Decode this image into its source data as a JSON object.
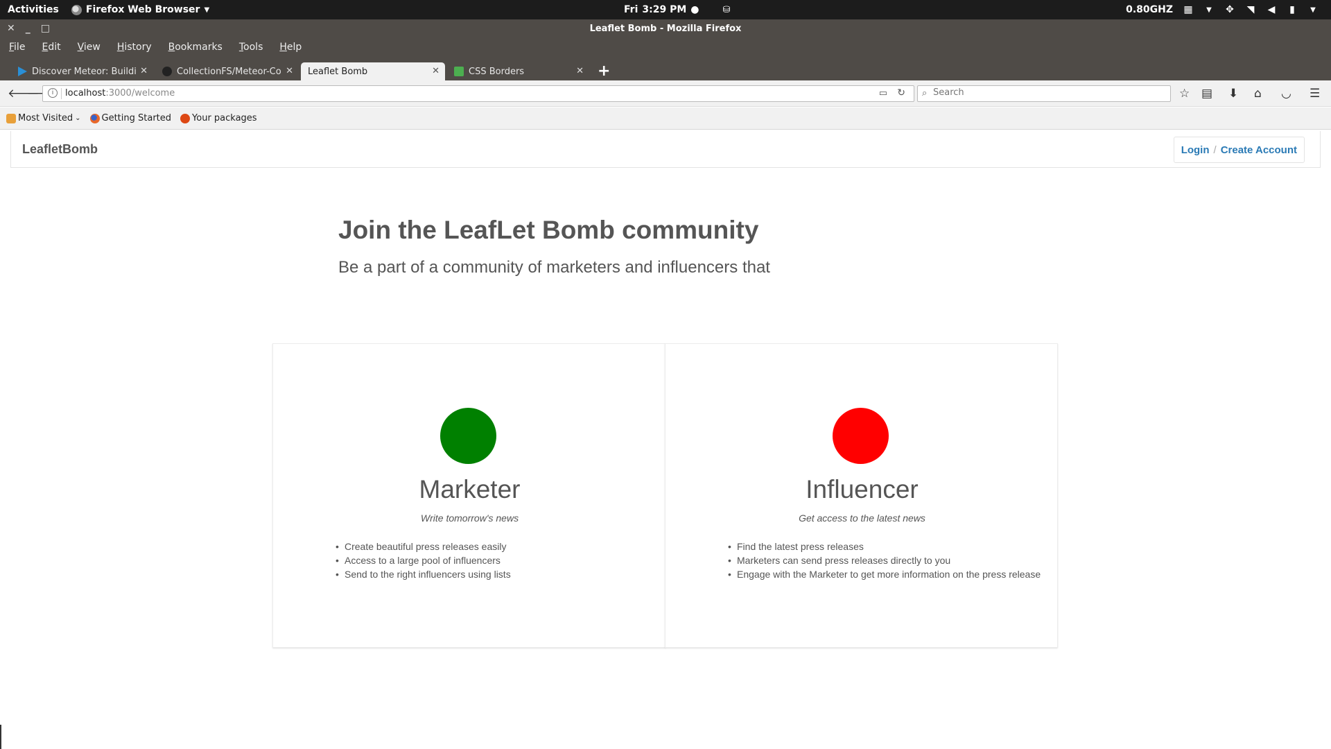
{
  "topbar": {
    "activities": "Activities",
    "app_name": "Firefox Web Browser",
    "clock_day": "Fri",
    "clock_time": "3:29 PM",
    "cpu": "0.80GHZ"
  },
  "window": {
    "title": "Leaflet Bomb - Mozilla Firefox"
  },
  "menu": [
    "File",
    "Edit",
    "View",
    "History",
    "Bookmarks",
    "Tools",
    "Help"
  ],
  "tabs": [
    {
      "label": "Discover Meteor: Building",
      "icon": "play-icon",
      "color": "#2a8fd6"
    },
    {
      "label": "CollectionFS/Meteor-Coll",
      "icon": "github-icon",
      "color": "#222222"
    },
    {
      "label": "Leaflet Bomb",
      "icon": "none",
      "color": "#ffffff"
    },
    {
      "label": "CSS Borders",
      "icon": "w3schools-icon",
      "color": "#4caf50"
    }
  ],
  "address": {
    "host": "localhost",
    "path": ":3000/welcome",
    "search_placeholder": "Search"
  },
  "bookmarks": [
    {
      "label": "Most Visited",
      "icon": "most-visited-icon"
    },
    {
      "label": "Getting Started",
      "icon": "firefox-icon"
    },
    {
      "label": "Your packages",
      "icon": "ubuntu-icon"
    }
  ],
  "site": {
    "brand": "LeafletBomb",
    "login": "Login",
    "separator": "/",
    "create_account": "Create Account"
  },
  "hero": {
    "title": "Join the LeafLet Bomb community",
    "subtitle": "Be a part of a community of marketers and influencers that"
  },
  "cards": [
    {
      "title": "Marketer",
      "tagline": "Write tomorrow's news",
      "color": "#008000",
      "items": [
        "Create beautiful press releases easily",
        "Access to a large pool of influencers",
        "Send to the right influencers using lists"
      ]
    },
    {
      "title": "Influencer",
      "tagline": "Get access to the latest news",
      "color": "#ff0000",
      "items": [
        "Find the latest press releases",
        "Marketers can send press releases directly to you",
        "Engage with the Marketer to get more information on the press release"
      ]
    }
  ]
}
